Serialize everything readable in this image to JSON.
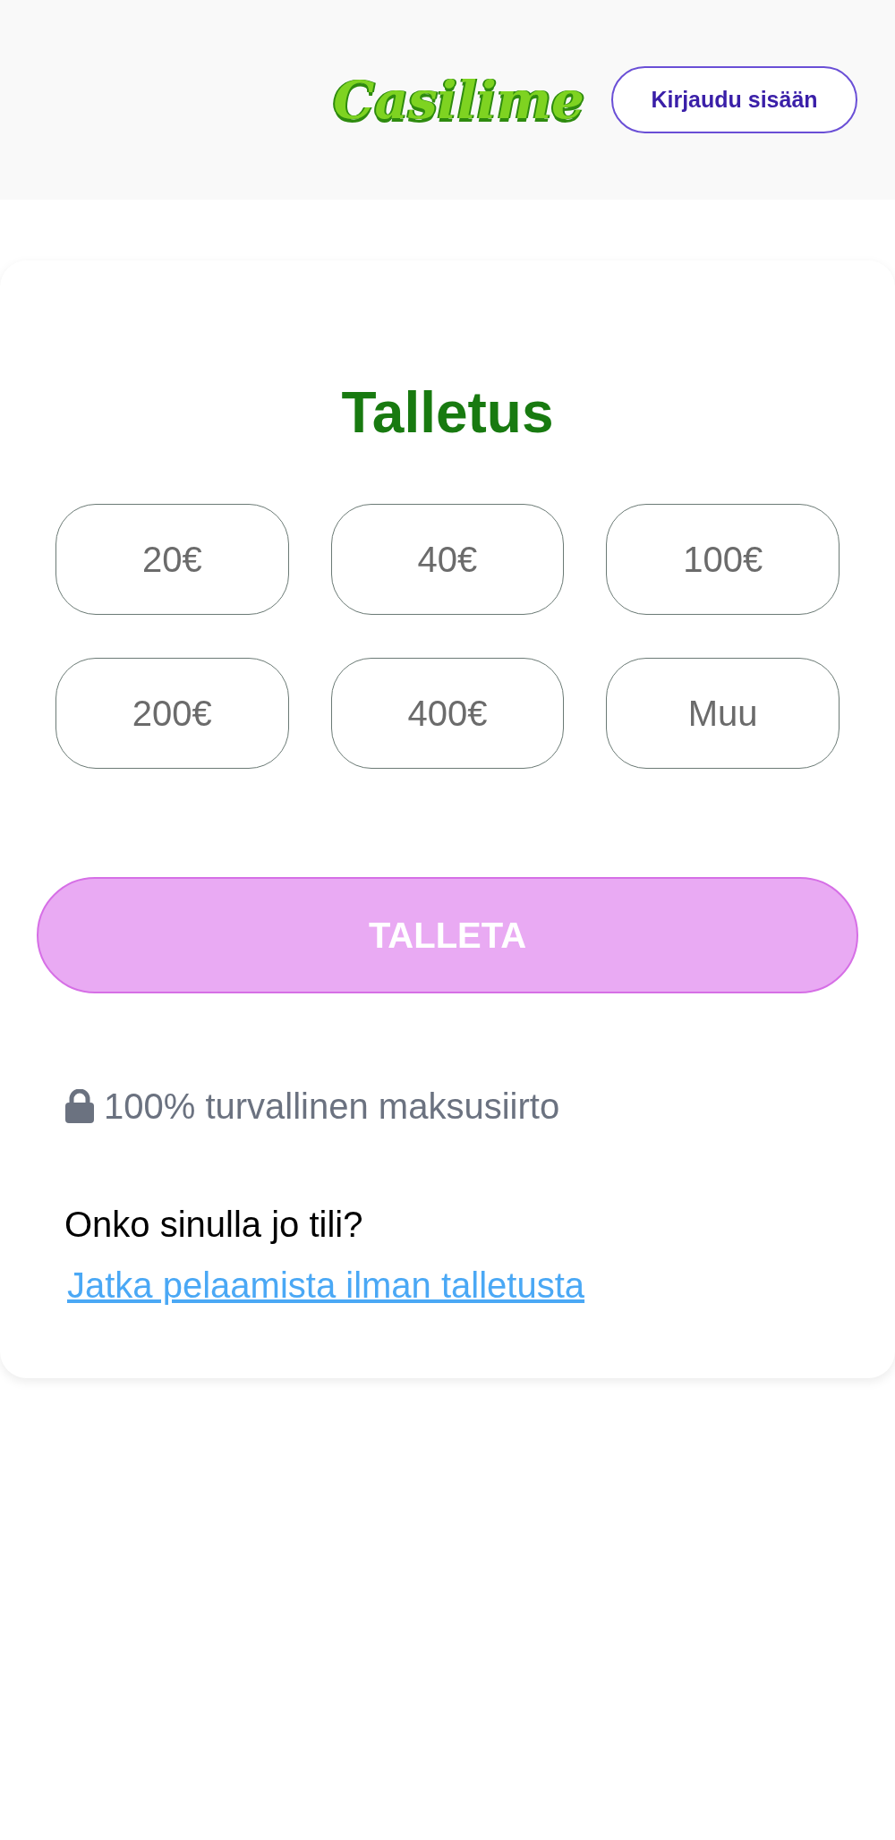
{
  "header": {
    "logo": "Casilime",
    "login_button": "Kirjaudu sisään"
  },
  "deposit": {
    "title": "Talletus",
    "amounts": [
      {
        "label": "20€",
        "selected": false
      },
      {
        "label": "40€",
        "selected": false
      },
      {
        "label": "100€",
        "selected": false
      },
      {
        "label": "200€",
        "selected": false
      },
      {
        "label": "400€",
        "selected": false
      },
      {
        "label": "Muu",
        "selected": false
      }
    ],
    "submit": {
      "label": "TALLETA",
      "disabled": true
    },
    "security_note": "100% turvallinen maksusiirto",
    "account_question": "Onko sinulla jo tili?",
    "continue_link": "Jatka pelaamista ilman talletusta"
  }
}
